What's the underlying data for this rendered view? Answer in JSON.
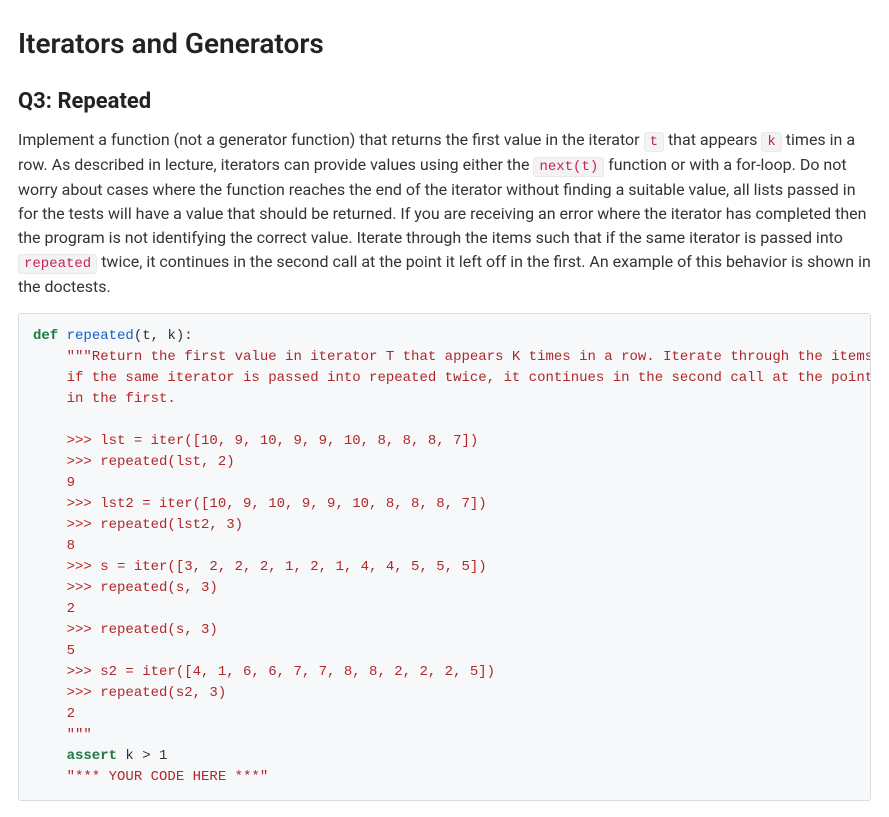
{
  "title": "Iterators and Generators",
  "question": "Q3: Repeated",
  "desc": {
    "p1a": "Implement a function (not a generator function) that returns the first value in the iterator ",
    "code_t": "t",
    "p1b": " that appears ",
    "code_k": "k",
    "p1c": " times in a row. As described in lecture, iterators can provide values using either the ",
    "code_next": "next(t)",
    "p1d": " function or with a for-loop. Do not worry about cases where the function reaches the end of the iterator without finding a suitable value, all lists passed in for the tests will have a value that should be returned. If you are receiving an error where the iterator has completed then the program is not identifying the correct value. Iterate through the items such that if the same iterator is passed into ",
    "code_rep": "repeated",
    "p1e": " twice, it continues in the second call at the point it left off in the first. An example of this behavior is shown in the doctests."
  },
  "code": {
    "def_kw": "def",
    "def_fn": "repeated",
    "def_sig": "(t, k):",
    "doc_open": "    \"\"\"Return the first value in iterator T that appears K times in a row. Iterate through the items such that\n    if the same iterator is passed into repeated twice, it continues in the second call at the point it left off\n    in the first.\n\n    >>> lst = iter([10, 9, 10, 9, 9, 10, 8, 8, 8, 7])\n    >>> repeated(lst, 2)\n    9\n    >>> lst2 = iter([10, 9, 10, 9, 9, 10, 8, 8, 8, 7])\n    >>> repeated(lst2, 3)\n    8\n    >>> s = iter([3, 2, 2, 2, 1, 2, 1, 4, 4, 5, 5, 5])\n    >>> repeated(s, 3)\n    2\n    >>> repeated(s, 3)\n    5\n    >>> s2 = iter([4, 1, 6, 6, 7, 7, 8, 8, 2, 2, 2, 5])\n    >>> repeated(s2, 3)\n    2\n    \"\"\"",
    "assert_kw": "    assert",
    "assert_rest": " k > 1",
    "stub": "    \"*** YOUR CODE HERE ***\""
  }
}
